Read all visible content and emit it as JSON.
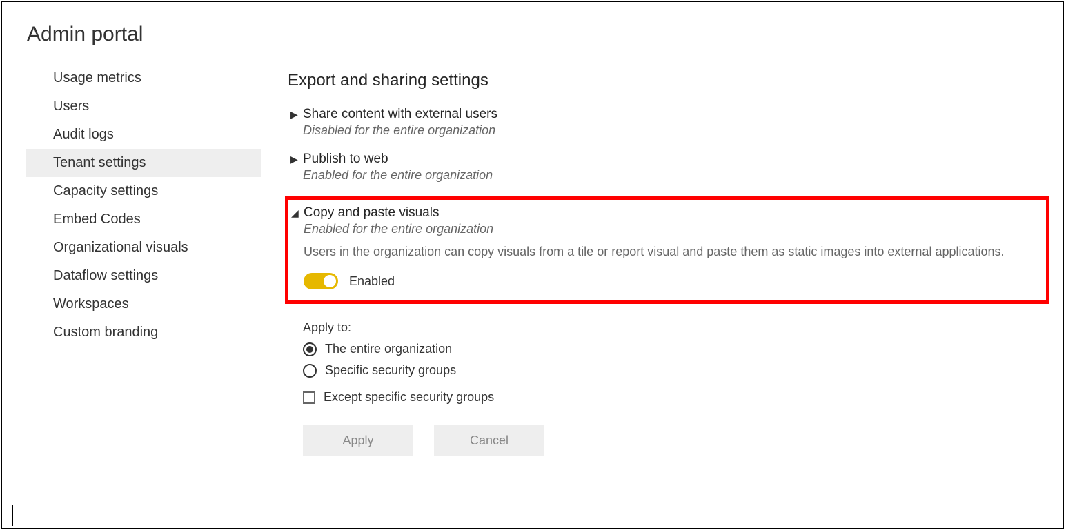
{
  "header": {
    "title": "Admin portal"
  },
  "sidebar": {
    "items": [
      {
        "label": "Usage metrics",
        "active": false
      },
      {
        "label": "Users",
        "active": false
      },
      {
        "label": "Audit logs",
        "active": false
      },
      {
        "label": "Tenant settings",
        "active": true
      },
      {
        "label": "Capacity settings",
        "active": false
      },
      {
        "label": "Embed Codes",
        "active": false
      },
      {
        "label": "Organizational visuals",
        "active": false
      },
      {
        "label": "Dataflow settings",
        "active": false
      },
      {
        "label": "Workspaces",
        "active": false
      },
      {
        "label": "Custom branding",
        "active": false
      }
    ]
  },
  "main": {
    "section_title": "Export and sharing settings",
    "settings": [
      {
        "name": "Share content with external users",
        "status": "Disabled for the entire organization",
        "expanded": false
      },
      {
        "name": "Publish to web",
        "status": "Enabled for the entire organization",
        "expanded": false
      },
      {
        "name": "Copy and paste visuals",
        "status": "Enabled for the entire organization",
        "expanded": true,
        "description": "Users in the organization can copy visuals from a tile or report visual and paste them as static images into external applications.",
        "toggle_label": "Enabled"
      }
    ],
    "apply_to": {
      "label": "Apply to:",
      "options": [
        {
          "label": "The entire organization",
          "selected": true
        },
        {
          "label": "Specific security groups",
          "selected": false
        }
      ],
      "except_label": "Except specific security groups",
      "except_checked": false
    },
    "buttons": {
      "apply": "Apply",
      "cancel": "Cancel"
    }
  }
}
